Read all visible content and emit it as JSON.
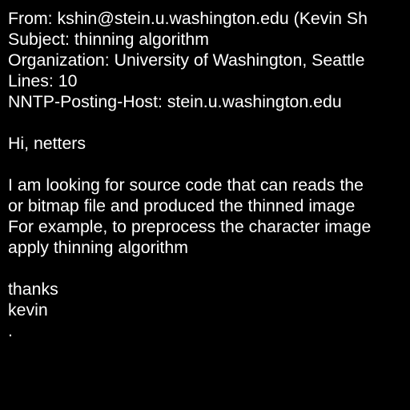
{
  "colors": {
    "background": "#000000",
    "text": "#ffffff"
  },
  "headers": {
    "from": "From: kshin@stein.u.washington.edu (Kevin Sh",
    "subject": "Subject: thinning algorithm",
    "organization": "Organization: University of Washington, Seattle",
    "lines": "Lines: 10",
    "nntp_host": "NNTP-Posting-Host: stein.u.washington.edu"
  },
  "body": {
    "greeting": "Hi, netters",
    "paragraph": [
      "I am looking for source code that can reads the",
      "or bitmap file and produced the thinned image",
      "For example, to preprocess the character image",
      "apply thinning algorithm"
    ],
    "signoff": "thanks",
    "signature": "kevin",
    "end_mark": "."
  }
}
